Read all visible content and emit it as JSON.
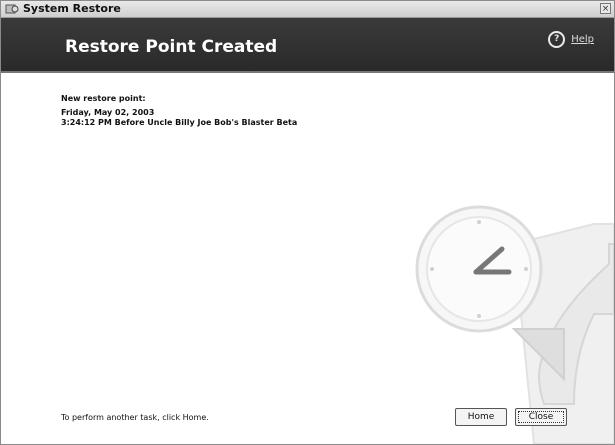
{
  "window": {
    "title": "System Restore"
  },
  "header": {
    "title": "Restore Point Created",
    "help_label": "Help",
    "help_glyph": "?"
  },
  "content": {
    "label": "New restore point:",
    "date": "Friday, May 02, 2003",
    "time_and_name": "3:24:12 PM  Before Uncle Billy Joe Bob's Blaster Beta"
  },
  "footer": {
    "instruction": "To perform another task, click Home.",
    "home_button": "Home",
    "close_button": "Close"
  },
  "icons": {
    "app": "system-restore-icon",
    "help": "help-icon",
    "window_close": "close-icon",
    "illustration": "clock-arrow-illustration"
  }
}
